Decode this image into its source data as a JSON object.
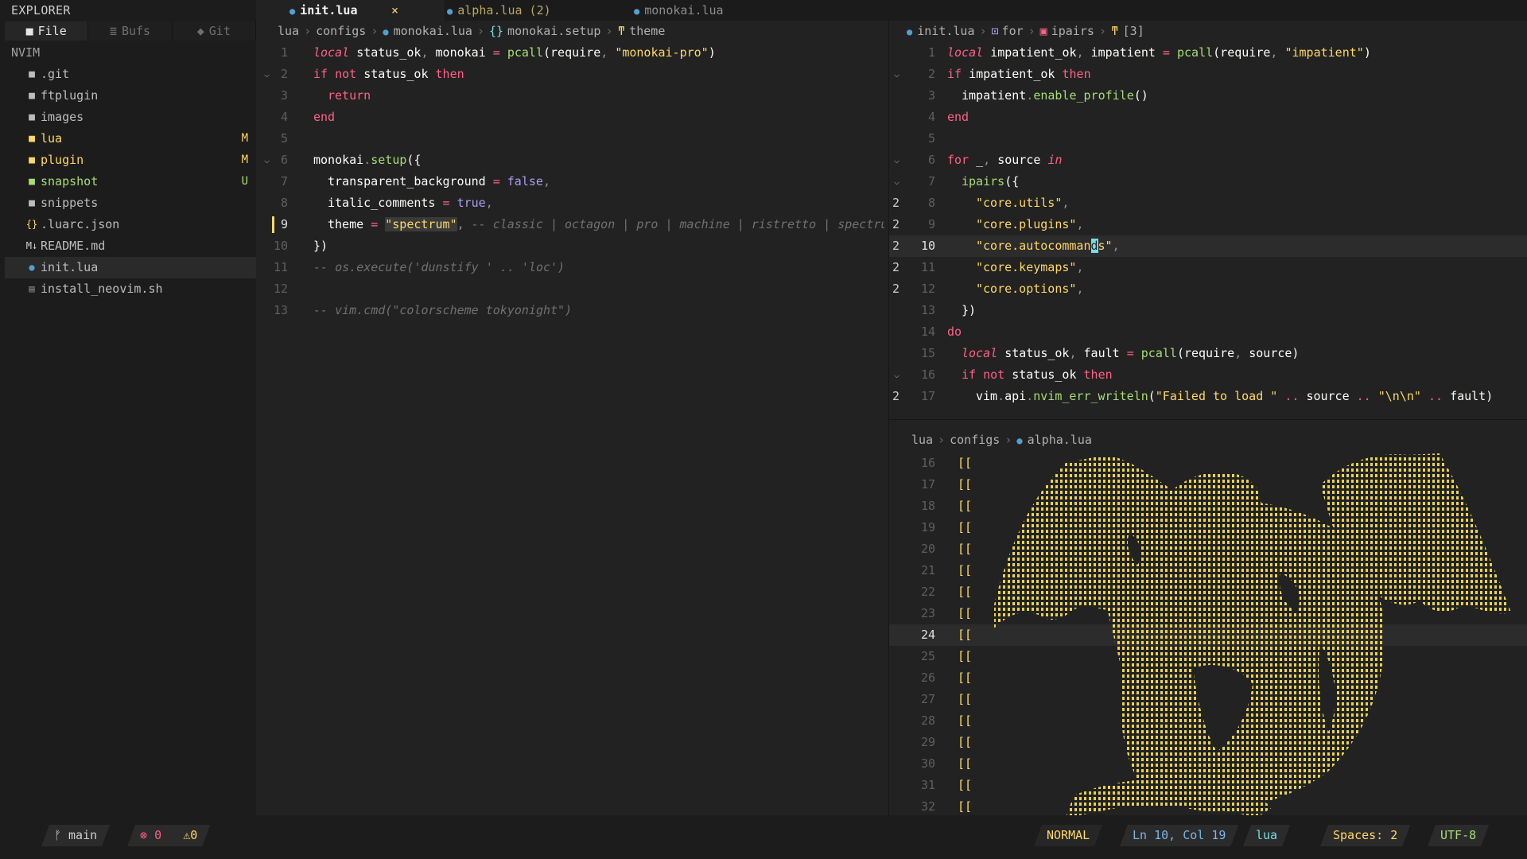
{
  "sidebar": {
    "header": "EXPLORER",
    "tabs": [
      {
        "icon": "folder-icon",
        "label": "File"
      },
      {
        "icon": "buffers-icon",
        "label": "Bufs"
      },
      {
        "icon": "git-icon",
        "label": "Git"
      }
    ],
    "root": "NVIM",
    "items": [
      {
        "name": ".git",
        "type": "folder",
        "badge": "",
        "color": "#bdbdbd"
      },
      {
        "name": "ftplugin",
        "type": "folder",
        "badge": "",
        "color": "#bdbdbd"
      },
      {
        "name": "images",
        "type": "folder",
        "badge": "",
        "color": "#bdbdbd"
      },
      {
        "name": "lua",
        "type": "folder",
        "badge": "M",
        "color": "#ffd866"
      },
      {
        "name": "plugin",
        "type": "folder",
        "badge": "M",
        "color": "#ffd866"
      },
      {
        "name": "snapshot",
        "type": "folder",
        "badge": "U",
        "color": "#a9dc76"
      },
      {
        "name": "snippets",
        "type": "folder",
        "badge": "",
        "color": "#bdbdbd"
      },
      {
        "name": ".luarc.json",
        "type": "json",
        "badge": "",
        "color": "#bdbdbd"
      },
      {
        "name": "README.md",
        "type": "markdown",
        "badge": "",
        "color": "#bdbdbd"
      },
      {
        "name": "init.lua",
        "type": "lua",
        "badge": "",
        "color": "#bdbdbd",
        "selected": true
      },
      {
        "name": "install_neovim.sh",
        "type": "shell",
        "badge": "",
        "color": "#bdbdbd"
      }
    ]
  },
  "tabs": [
    {
      "label": "init.lua",
      "active": true,
      "close": "×"
    },
    {
      "label": "alpha.lua (2)",
      "active": false
    },
    {
      "label": "monokai.lua",
      "active": false
    }
  ],
  "left_pane": {
    "breadcrumb": [
      "lua",
      "configs",
      "monokai.lua",
      "monokai.setup",
      "theme"
    ],
    "current_line": 9
  },
  "right_top_pane": {
    "breadcrumb": [
      "init.lua",
      "for",
      "ipairs",
      "[3]"
    ],
    "current_line": 10
  },
  "right_bottom_pane": {
    "breadcrumb": [
      "lua",
      "configs",
      "alpha.lua"
    ],
    "line_numbers": [
      16,
      17,
      18,
      19,
      20,
      21,
      22,
      23,
      24,
      25,
      26,
      27,
      28,
      29,
      30,
      31,
      32
    ],
    "current_line": 24,
    "line_text": "[["
  },
  "statusbar": {
    "branch": "main",
    "errors": "0",
    "warnings": "0",
    "mode": "NORMAL",
    "position": "Ln 10, Col 19",
    "language": "lua",
    "spaces": "Spaces: 2",
    "encoding": "UTF-8"
  },
  "colors": {
    "background": "#222222",
    "keyword": "#ff6188",
    "function": "#a9dc76",
    "string": "#ffd866",
    "boolean": "#ab9df2",
    "comment": "#727072",
    "lua_icon": "#51a0cf"
  }
}
